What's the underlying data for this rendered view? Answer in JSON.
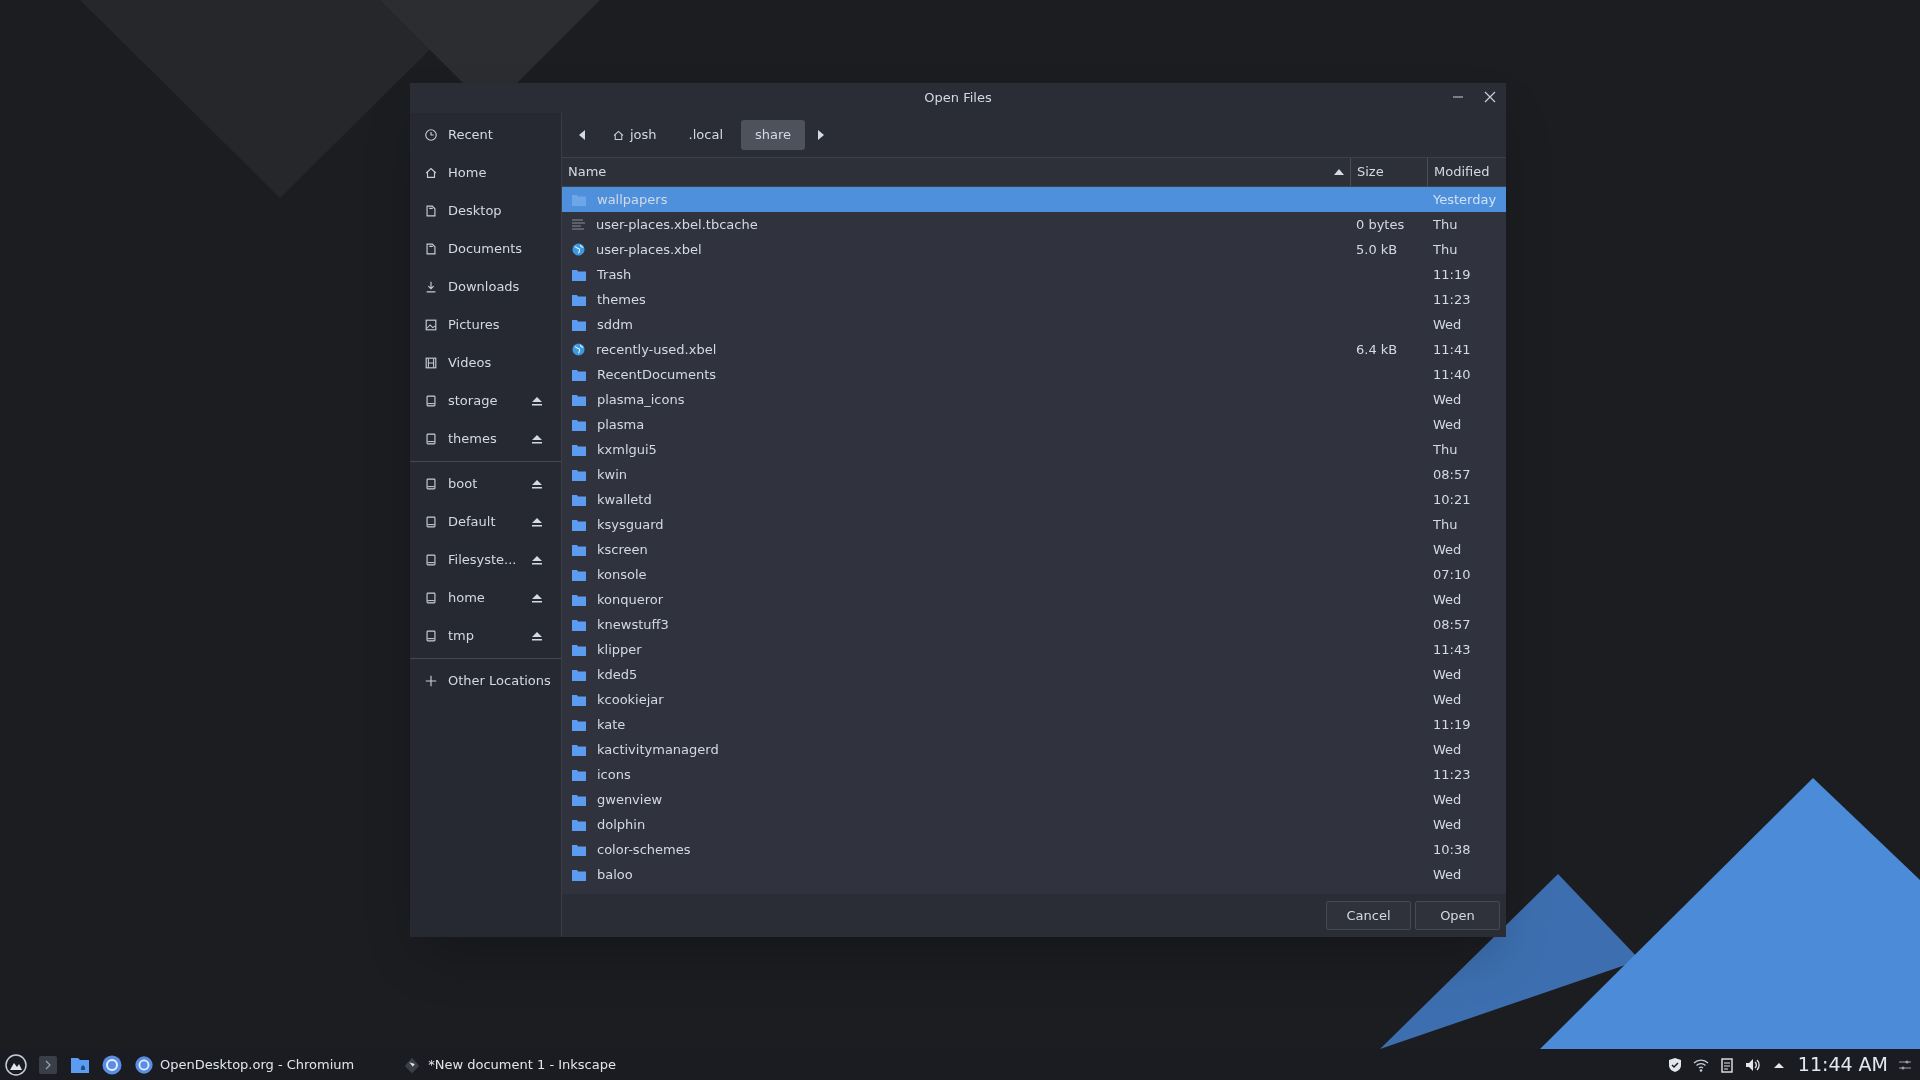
{
  "window": {
    "title": "Open Files"
  },
  "sidebar": {
    "groups": [
      [
        {
          "label": "Recent",
          "kind": "clock",
          "eject": false
        },
        {
          "label": "Home",
          "kind": "home",
          "eject": false
        },
        {
          "label": "Desktop",
          "kind": "document",
          "eject": false
        },
        {
          "label": "Documents",
          "kind": "document",
          "eject": false
        },
        {
          "label": "Downloads",
          "kind": "download",
          "eject": false
        },
        {
          "label": "Pictures",
          "kind": "picture",
          "eject": false
        },
        {
          "label": "Videos",
          "kind": "film",
          "eject": false
        },
        {
          "label": "storage",
          "kind": "drive",
          "eject": true
        },
        {
          "label": "themes",
          "kind": "drive",
          "eject": true
        }
      ],
      [
        {
          "label": "boot",
          "kind": "drive",
          "eject": true
        },
        {
          "label": "Default",
          "kind": "drive",
          "eject": true
        },
        {
          "label": "Filesyste...",
          "kind": "drive",
          "eject": true
        },
        {
          "label": "home",
          "kind": "drive",
          "eject": true
        },
        {
          "label": "tmp",
          "kind": "drive",
          "eject": true
        }
      ],
      [
        {
          "label": "Other Locations",
          "kind": "plus"
        }
      ]
    ]
  },
  "path": [
    {
      "label": "josh",
      "home": true,
      "selected": false
    },
    {
      "label": ".local",
      "home": false,
      "selected": false
    },
    {
      "label": "share",
      "home": false,
      "selected": true
    }
  ],
  "table": {
    "columns": [
      {
        "label": "Name",
        "sorted": true
      },
      {
        "label": "Size",
        "sorted": false
      },
      {
        "label": "Modified",
        "sorted": false
      }
    ],
    "rows": [
      {
        "kind": "folder",
        "name": "wallpapers",
        "size": "",
        "modified": "Yesterday",
        "selected": true
      },
      {
        "kind": "text",
        "name": "user-places.xbel.tbcache",
        "size": "0 bytes",
        "modified": "Thu",
        "selected": false
      },
      {
        "kind": "web",
        "name": "user-places.xbel",
        "size": "5.0 kB",
        "modified": "Thu",
        "selected": false
      },
      {
        "kind": "folder",
        "name": "Trash",
        "size": "",
        "modified": "11:19",
        "selected": false
      },
      {
        "kind": "folder",
        "name": "themes",
        "size": "",
        "modified": "11:23",
        "selected": false
      },
      {
        "kind": "folder",
        "name": "sddm",
        "size": "",
        "modified": "Wed",
        "selected": false
      },
      {
        "kind": "web",
        "name": "recently-used.xbel",
        "size": "6.4 kB",
        "modified": "11:41",
        "selected": false
      },
      {
        "kind": "folder",
        "name": "RecentDocuments",
        "size": "",
        "modified": "11:40",
        "selected": false
      },
      {
        "kind": "folder",
        "name": "plasma_icons",
        "size": "",
        "modified": "Wed",
        "selected": false
      },
      {
        "kind": "folder",
        "name": "plasma",
        "size": "",
        "modified": "Wed",
        "selected": false
      },
      {
        "kind": "folder",
        "name": "kxmlgui5",
        "size": "",
        "modified": "Thu",
        "selected": false
      },
      {
        "kind": "folder",
        "name": "kwin",
        "size": "",
        "modified": "08:57",
        "selected": false
      },
      {
        "kind": "folder",
        "name": "kwalletd",
        "size": "",
        "modified": "10:21",
        "selected": false
      },
      {
        "kind": "folder",
        "name": "ksysguard",
        "size": "",
        "modified": "Thu",
        "selected": false
      },
      {
        "kind": "folder",
        "name": "kscreen",
        "size": "",
        "modified": "Wed",
        "selected": false
      },
      {
        "kind": "folder",
        "name": "konsole",
        "size": "",
        "modified": "07:10",
        "selected": false
      },
      {
        "kind": "folder",
        "name": "konqueror",
        "size": "",
        "modified": "Wed",
        "selected": false
      },
      {
        "kind": "folder",
        "name": "knewstuff3",
        "size": "",
        "modified": "08:57",
        "selected": false
      },
      {
        "kind": "folder",
        "name": "klipper",
        "size": "",
        "modified": "11:43",
        "selected": false
      },
      {
        "kind": "folder",
        "name": "kded5",
        "size": "",
        "modified": "Wed",
        "selected": false
      },
      {
        "kind": "folder",
        "name": "kcookiejar",
        "size": "",
        "modified": "Wed",
        "selected": false
      },
      {
        "kind": "folder",
        "name": "kate",
        "size": "",
        "modified": "11:19",
        "selected": false
      },
      {
        "kind": "folder",
        "name": "kactivitymanagerd",
        "size": "",
        "modified": "Wed",
        "selected": false
      },
      {
        "kind": "folder",
        "name": "icons",
        "size": "",
        "modified": "11:23",
        "selected": false
      },
      {
        "kind": "folder",
        "name": "gwenview",
        "size": "",
        "modified": "Wed",
        "selected": false
      },
      {
        "kind": "folder",
        "name": "dolphin",
        "size": "",
        "modified": "Wed",
        "selected": false
      },
      {
        "kind": "folder",
        "name": "color-schemes",
        "size": "",
        "modified": "10:38",
        "selected": false
      },
      {
        "kind": "folder",
        "name": "baloo",
        "size": "",
        "modified": "Wed",
        "selected": false
      }
    ]
  },
  "buttons": [
    "Cancel",
    "Open"
  ],
  "taskbar": {
    "launchers": [
      {
        "kind": "menu"
      },
      {
        "kind": "terminal"
      },
      {
        "kind": "files"
      },
      {
        "kind": "browser"
      }
    ],
    "tasks": [
      {
        "label": "OpenDesktop.org - Chromium",
        "kind": "browser"
      },
      {
        "label": "*New document 1 - Inkscape",
        "kind": "inkscape"
      }
    ],
    "tray": [
      {
        "kind": "shield"
      },
      {
        "kind": "wifi"
      },
      {
        "kind": "clipboard"
      },
      {
        "kind": "volume"
      },
      {
        "kind": "arrow"
      }
    ],
    "clock": "11:44 AM"
  }
}
